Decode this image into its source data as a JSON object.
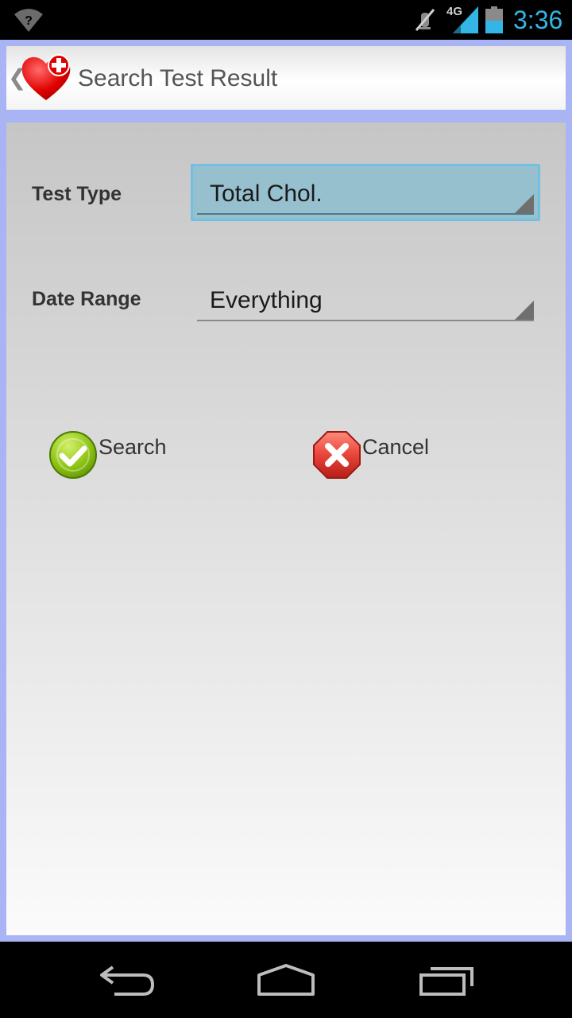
{
  "status_bar": {
    "time": "3:36",
    "network_type": "4G",
    "icons": [
      "wifi-unknown-icon",
      "mute-icon",
      "signal-icon",
      "battery-icon"
    ],
    "clock_color": "#33b5e5"
  },
  "action_bar": {
    "title": "Search Test Result",
    "logo_icon": "heart-plus-icon",
    "up_icon": "up-caret-icon"
  },
  "form": {
    "test_type": {
      "label": "Test Type",
      "selected": "Total Chol."
    },
    "date_range": {
      "label": "Date Range",
      "selected": "Everything"
    }
  },
  "actions": {
    "search": {
      "label": "Search",
      "icon": "check-icon",
      "color": "#8cc412"
    },
    "cancel": {
      "label": "Cancel",
      "icon": "close-icon",
      "color": "#e8443a"
    }
  },
  "nav_bar": {
    "icons": [
      "back-icon",
      "home-icon",
      "recent-apps-icon"
    ]
  },
  "colors": {
    "frame": "#a9b4f4",
    "focus_spinner": "#97c0cf"
  }
}
